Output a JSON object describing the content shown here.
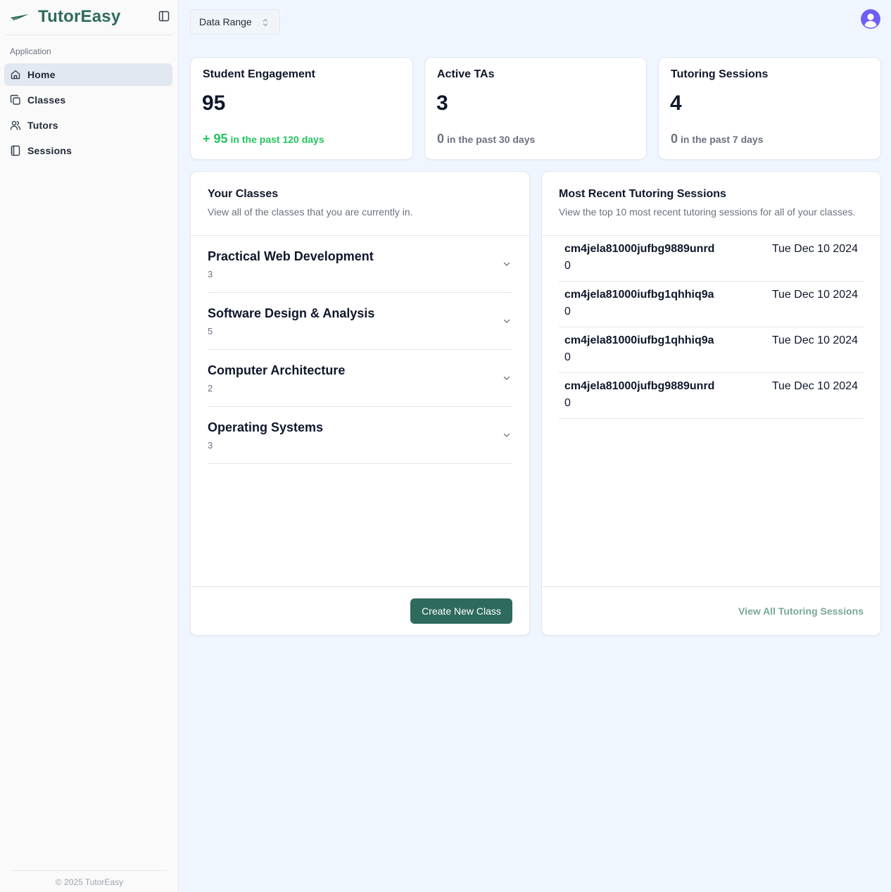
{
  "app": {
    "name": "TutorEasy",
    "brand_color": "#2e6b5e",
    "logo_icon": "paper-plane-icon"
  },
  "sidebar": {
    "group_label": "Application",
    "items": [
      {
        "label": "Home",
        "icon": "home-icon",
        "active": true
      },
      {
        "label": "Classes",
        "icon": "copy-icon",
        "active": false
      },
      {
        "label": "Tutors",
        "icon": "users-icon",
        "active": false
      },
      {
        "label": "Sessions",
        "icon": "book-icon",
        "active": false
      }
    ],
    "footer": "© 2025 TutorEasy"
  },
  "topbar": {
    "range_label": "Data Range"
  },
  "stats": [
    {
      "title": "Student Engagement",
      "value": "95",
      "delta": "+ 95",
      "delta_suffix": "in the past 120 days",
      "color": "#22c55e"
    },
    {
      "title": "Active TAs",
      "value": "3",
      "delta": "0",
      "delta_suffix": "in the past 30 days",
      "color": "#6b7280"
    },
    {
      "title": "Tutoring Sessions",
      "value": "4",
      "delta": "0",
      "delta_suffix": "in the past 7 days",
      "color": "#6b7280"
    }
  ],
  "classes_panel": {
    "title": "Your Classes",
    "description": "View all of the classes that you are currently in.",
    "items": [
      {
        "name": "Practical Web Development",
        "count": "3"
      },
      {
        "name": "Software Design & Analysis",
        "count": "5"
      },
      {
        "name": "Computer Architecture",
        "count": "2"
      },
      {
        "name": "Operating Systems",
        "count": "3"
      }
    ],
    "create_label": "Create New Class"
  },
  "sessions_panel": {
    "title": "Most Recent Tutoring Sessions",
    "description": "View the top 10 most recent tutoring sessions for all of your classes.",
    "items": [
      {
        "id": "cm4jela81000jufbg9889unrd",
        "date": "Tue Dec 10 2024",
        "count": "0"
      },
      {
        "id": "cm4jela81000iufbg1qhhiq9a",
        "date": "Tue Dec 10 2024",
        "count": "0"
      },
      {
        "id": "cm4jela81000iufbg1qhhiq9a",
        "date": "Tue Dec 10 2024",
        "count": "0"
      },
      {
        "id": "cm4jela81000jufbg9889unrd",
        "date": "Tue Dec 10 2024",
        "count": "0"
      }
    ],
    "view_all_label": "View All Tutoring Sessions"
  }
}
